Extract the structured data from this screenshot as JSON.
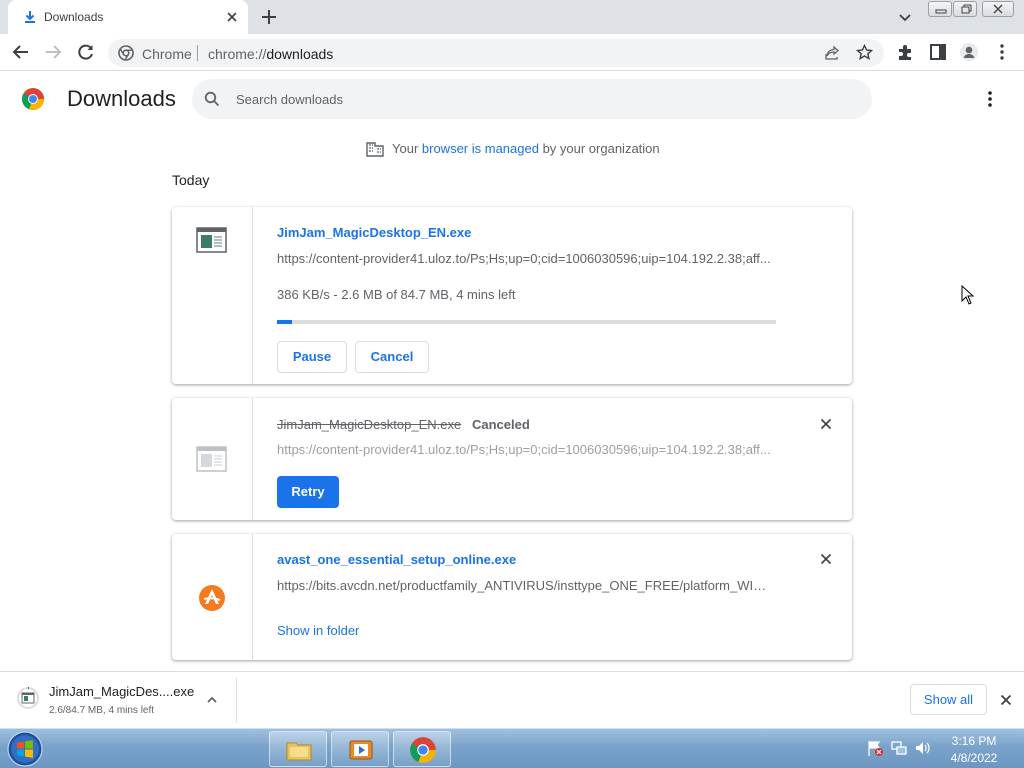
{
  "tab": {
    "title": "Downloads",
    "icon": "download-icon"
  },
  "omnibox": {
    "chip": "Chrome",
    "url_scheme": "chrome://",
    "url_path": "downloads"
  },
  "header": {
    "title": "Downloads",
    "search_placeholder": "Search downloads"
  },
  "managed": {
    "prefix": "Your ",
    "link": "browser is managed",
    "suffix": " by your organization"
  },
  "section": "Today",
  "downloads": [
    {
      "filename": "JimJam_MagicDesktop_EN.exe",
      "source": "https://content-provider41.uloz.to/Ps;Hs;up=0;cid=1006030596;uip=104.192.2.38;aff...",
      "status": "386 KB/s - 2.6 MB of 84.7 MB, 4 mins left",
      "progress_fraction": 0.031,
      "pause_label": "Pause",
      "cancel_label": "Cancel"
    },
    {
      "filename": "JimJam_MagicDesktop_EN.exe",
      "tag": "Canceled",
      "source": "https://content-provider41.uloz.to/Ps;Hs;up=0;cid=1006030596;uip=104.192.2.38;aff...",
      "retry_label": "Retry"
    },
    {
      "filename": "avast_one_essential_setup_online.exe",
      "source": "https://bits.avcdn.net/productfamily_ANTIVIRUS/insttype_ONE_FREE/platform_WIN/...",
      "show_label": "Show in folder"
    }
  ],
  "shelf": {
    "name": "JimJam_MagicDes....exe",
    "status": "2.6/84.7 MB, 4 mins left",
    "show_all": "Show all"
  },
  "taskbar": {
    "time": "3:16 PM",
    "date": "4/8/2022"
  },
  "colors": {
    "accent": "#1a73e8",
    "text_secondary": "#5f6368",
    "tab_strip": "#dee1e6",
    "avast_orange": "#f47a20"
  }
}
